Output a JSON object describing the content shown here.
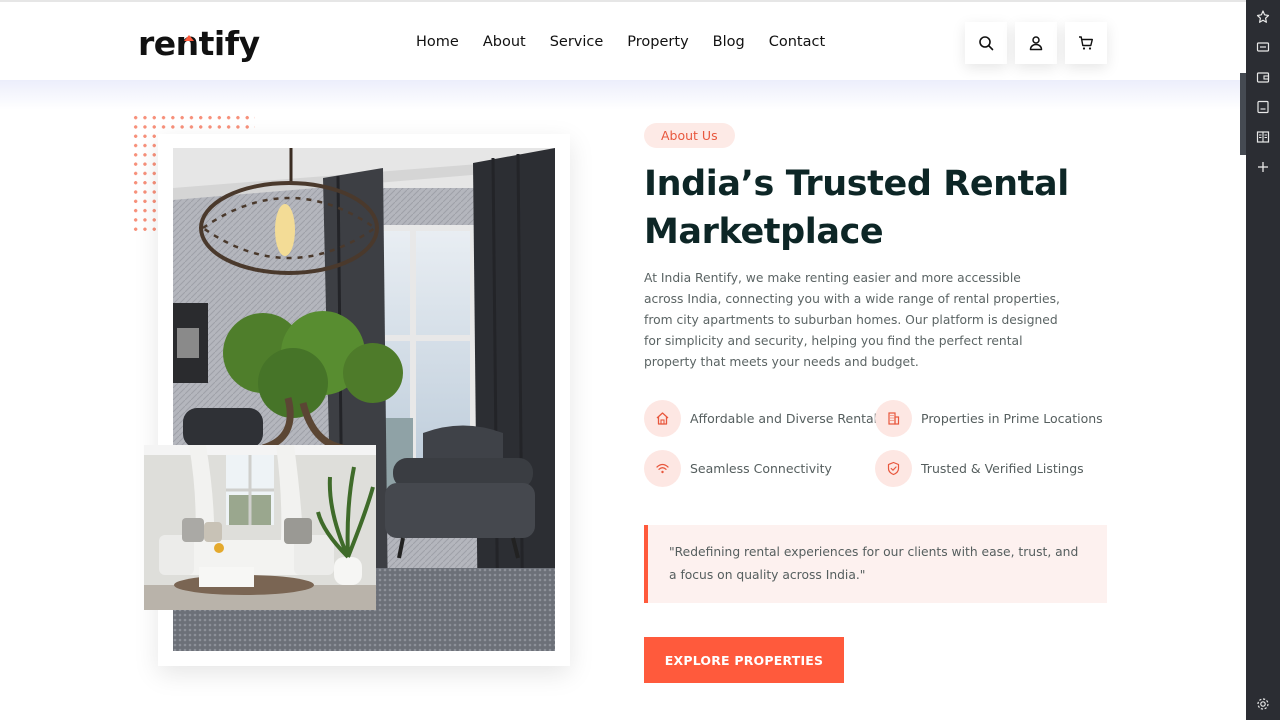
{
  "brand": {
    "logo_text_a": "re",
    "logo_text_b": "n",
    "logo_text_c": "tify",
    "accent": "#ff5a3c"
  },
  "nav": {
    "items": [
      "Home",
      "About",
      "Service",
      "Property",
      "Blog",
      "Contact"
    ]
  },
  "header_actions": [
    {
      "icon": "search-icon"
    },
    {
      "icon": "user-icon"
    },
    {
      "icon": "cart-icon"
    }
  ],
  "about": {
    "badge": "About Us",
    "title": "India’s Trusted Rental Marketplace",
    "description": "At India Rentify, we make renting easier and more accessible across India, connecting you with a wide range of rental properties, from city apartments to suburban homes. Our platform is designed for simplicity and security, helping you find the perfect rental property that meets your needs and budget.",
    "features": [
      {
        "label": "Affordable and Diverse Rentals",
        "icon": "home-icon"
      },
      {
        "label": "Properties in Prime Locations",
        "icon": "building-icon"
      },
      {
        "label": "Seamless Connectivity",
        "icon": "wifi-icon"
      },
      {
        "label": "Trusted & Verified Listings",
        "icon": "shield-check-icon"
      }
    ],
    "quote": "\"Redefining rental experiences for our clients with ease, trust, and a focus on quality across India.\"",
    "cta": "EXPLORE PROPERTIES"
  },
  "sidebar_tools": [
    "star-sparkle-icon",
    "video-icon",
    "wallet-icon",
    "save-icon",
    "book-icon",
    "plus-icon",
    "gear-icon"
  ]
}
